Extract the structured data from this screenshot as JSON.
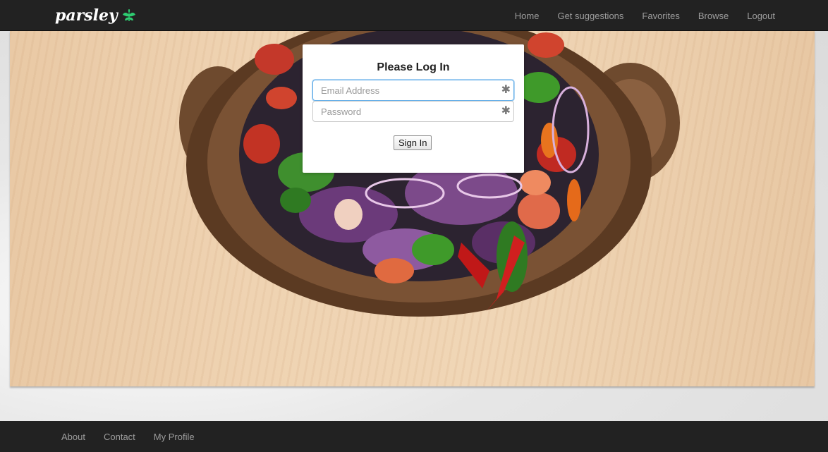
{
  "brand": {
    "name": "parsley",
    "accent": "#2ecc71"
  },
  "nav": {
    "items": [
      {
        "label": "Home"
      },
      {
        "label": "Get suggestions"
      },
      {
        "label": "Favorites"
      },
      {
        "label": "Browse"
      },
      {
        "label": "Logout"
      }
    ]
  },
  "login": {
    "title": "Please Log In",
    "email": {
      "placeholder": "Email Address",
      "value": "",
      "required_icon": "asterisk-icon"
    },
    "password": {
      "placeholder": "Password",
      "value": "",
      "required_icon": "asterisk-icon"
    },
    "submit_label": "Sign In"
  },
  "footer": {
    "items": [
      {
        "label": "About"
      },
      {
        "label": "Contact"
      },
      {
        "label": "My Profile"
      }
    ]
  },
  "colors": {
    "navbar_bg": "#222222",
    "nav_text": "#9d9d9d",
    "focus_border": "#66afe9"
  }
}
